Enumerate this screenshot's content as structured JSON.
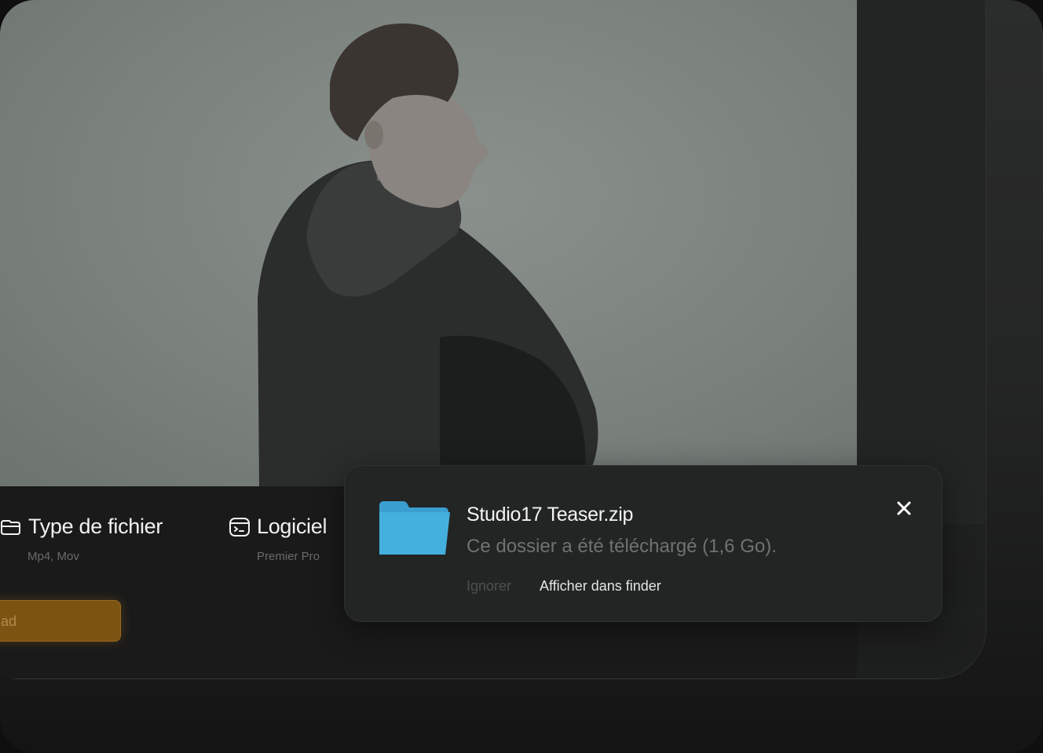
{
  "file_meta": [
    {
      "title": "Type de fichier",
      "subtitle": "Mp4, Mov",
      "icon": "file-stack-icon"
    },
    {
      "title": "Logiciel",
      "subtitle": "Premier Pro",
      "icon": "terminal-window-icon"
    }
  ],
  "download_button": {
    "label": "ad"
  },
  "notification": {
    "icon": "folder-icon",
    "title": "Studio17 Teaser.zip",
    "description": "Ce dossier a été téléchargé (1,6 Go).",
    "ignore_label": "Ignorer",
    "show_label": "Afficher dans finder",
    "close_icon": "close-icon"
  },
  "colors": {
    "accent_button": "#7d5312",
    "folder": "#44b0de",
    "notification_bg": "#232525"
  }
}
